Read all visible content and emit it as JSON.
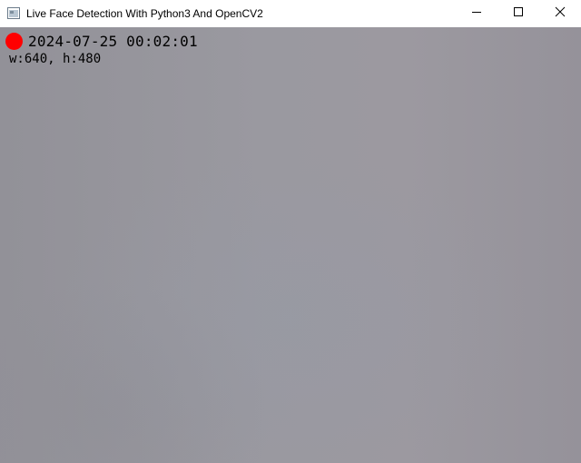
{
  "window": {
    "title": "Live Face Detection With Python3 And OpenCV2",
    "app_icon": "window-app-icon",
    "buttons": {
      "minimize_icon": "minimize-icon",
      "maximize_icon": "maximize-icon",
      "close_icon": "close-icon"
    }
  },
  "video": {
    "recording_indicator_color": "#ff0000",
    "timestamp": "2024-07-25 00:02:01",
    "dimensions_label": "w:640, h:480"
  }
}
